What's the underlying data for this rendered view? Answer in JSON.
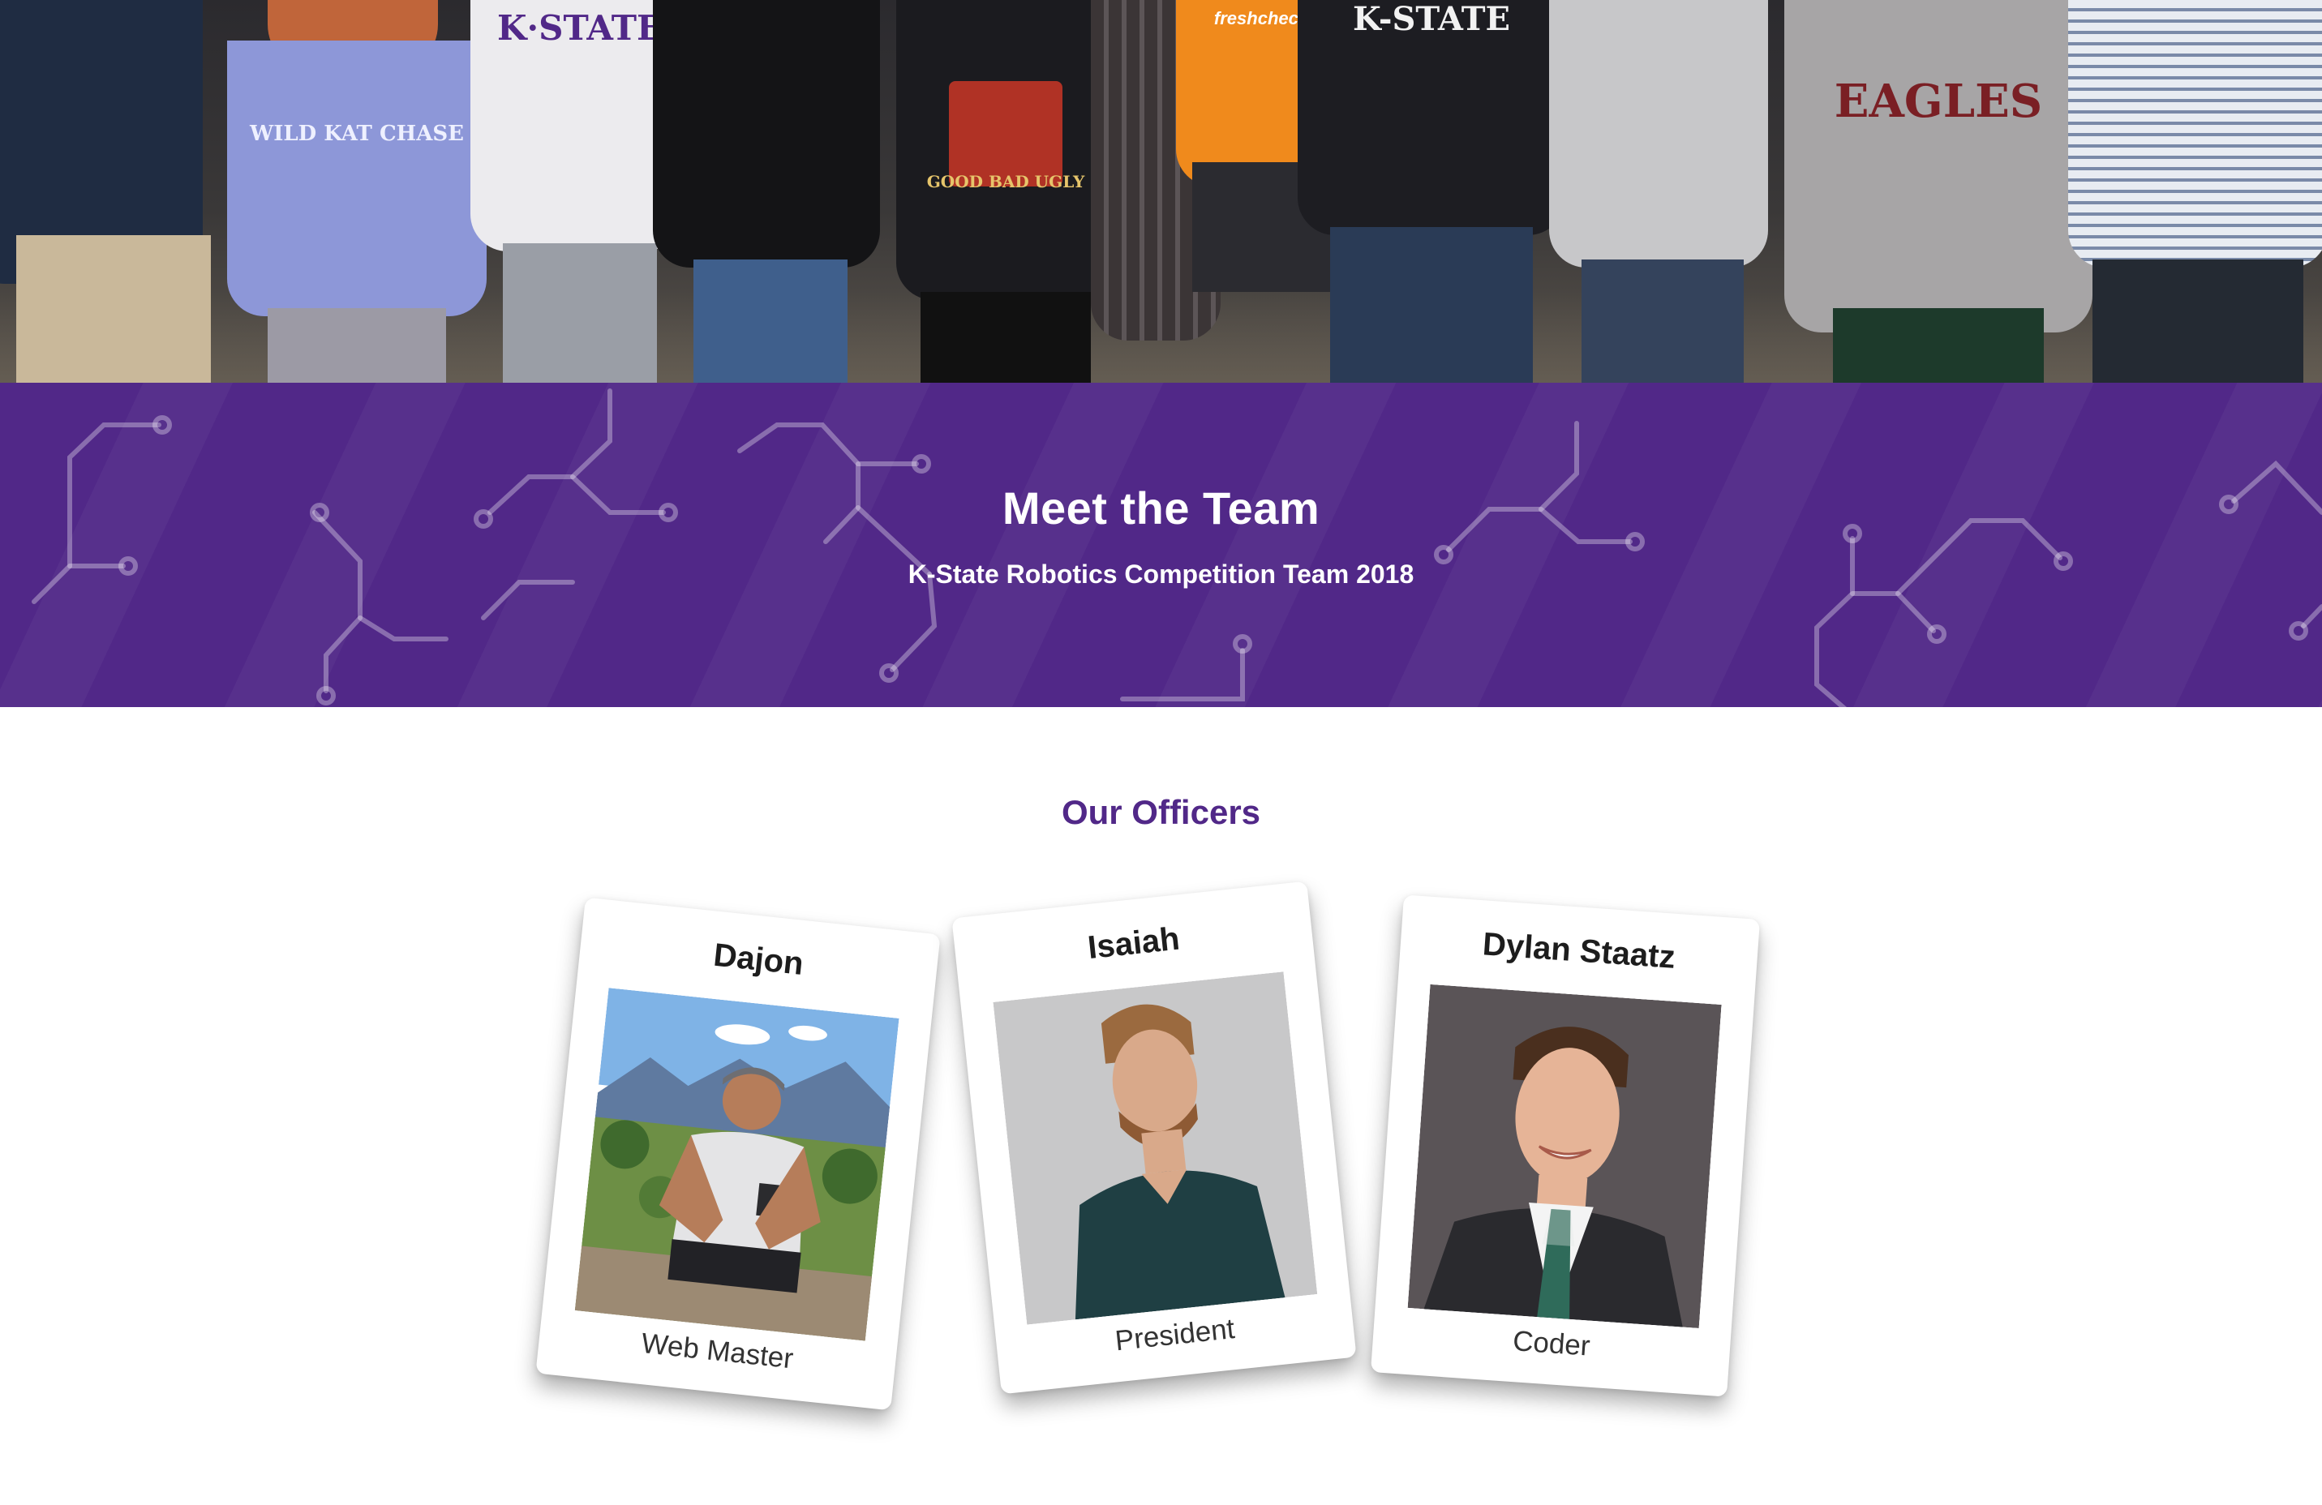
{
  "banner": {
    "title": "Meet the Team",
    "subtitle": "K-State Robotics Competition Team 2018",
    "color": "#512888"
  },
  "hero_photo": {
    "shirt_texts": [
      "K·STATE",
      "WILD KAT CHASE",
      "GOOD BAD UGLY",
      "K-STATE",
      "EAGLES",
      "freshcheck"
    ]
  },
  "officers": {
    "title": "Our Officers",
    "members": [
      {
        "name": "Dajon",
        "role": "Web Master"
      },
      {
        "name": "Isaiah",
        "role": "President"
      },
      {
        "name": "Dylan Staatz",
        "role": "Coder"
      }
    ]
  }
}
